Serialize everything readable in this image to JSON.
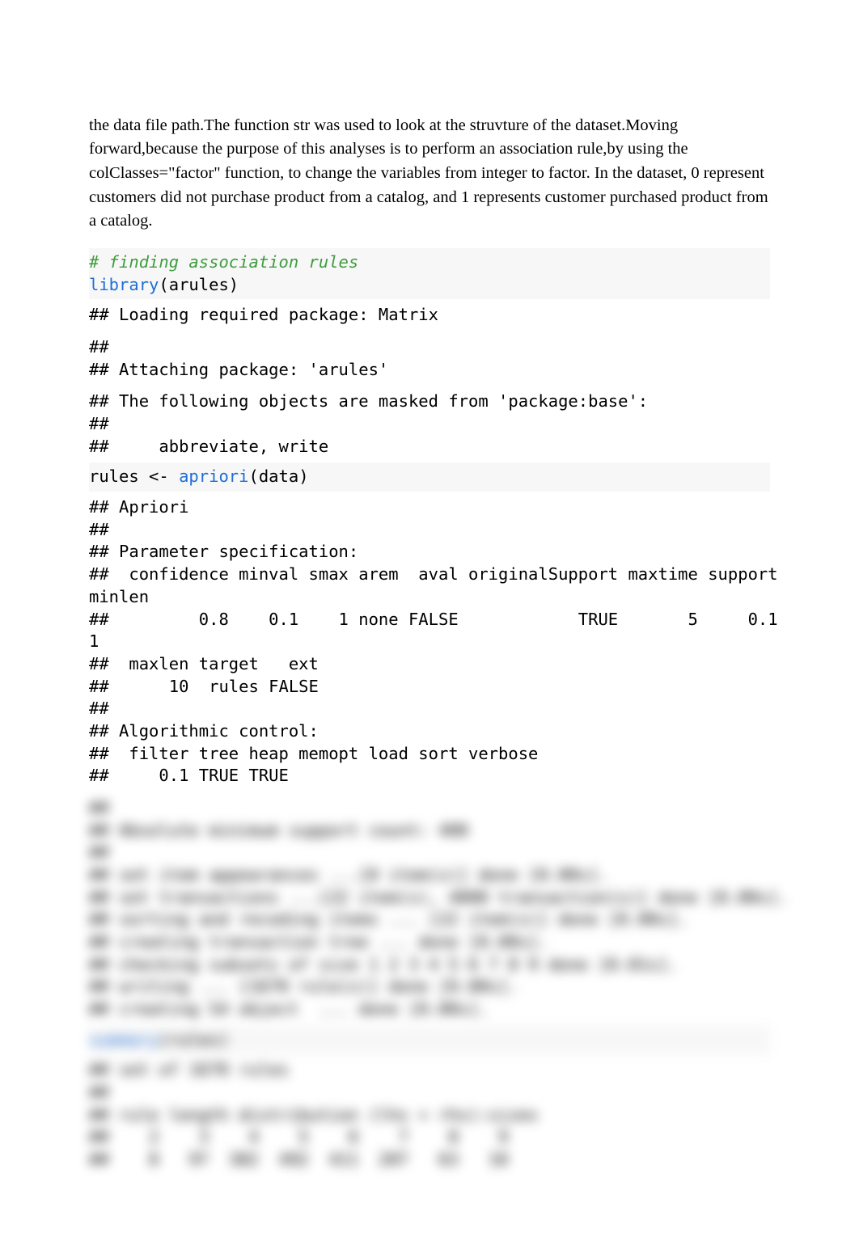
{
  "prose": {
    "p1": "the data file path.The function str was used to look at the struvture of the dataset.Moving forward,because the purpose of this analyses is to perform an association rule,by using the colClasses=\"factor\" function, to change the variables from integer to factor. In the dataset, 0 represent customers did not purchase product from a catalog, and 1 represents customer purchased product from a catalog."
  },
  "code1": {
    "comment": "# finding association rules",
    "fn_library": "library",
    "lib_arg": "(arules)"
  },
  "out1": {
    "line1": "## Loading required package: Matrix"
  },
  "out2": {
    "l1": "## ",
    "l2": "## Attaching package: 'arules'"
  },
  "out3": {
    "l1": "## The following objects are masked from 'package:base':",
    "l2": "## ",
    "l3": "##     abbreviate, write"
  },
  "code2": {
    "prefix": "rules <- ",
    "fn_apriori": "apriori",
    "arg": "(data)"
  },
  "out4": {
    "l1": "## Apriori",
    "l2": "## ",
    "l3": "## Parameter specification:",
    "l4": "##  confidence minval smax arem  aval originalSupport maxtime support",
    "l5": "minlen",
    "l6": "##         0.8    0.1    1 none FALSE            TRUE       5     0.1",
    "l7": "1",
    "l8": "##  maxlen target   ext",
    "l9": "##      10  rules FALSE",
    "l10": "## ",
    "l11": "## Algorithmic control:",
    "l12": "##  filter tree heap memopt load sort verbose",
    "l13": "##     0.1 TRUE TRUE  "
  },
  "blurred": {
    "l1": "##",
    "l2": "## Absolute minimum support count: 400",
    "l3": "##",
    "l4": "## set item appearances ...[0 item(s)] done [0.00s].",
    "l5": "## set transactions ...[22 item(s), 4000 transaction(s)] done [0.00s].",
    "l6": "## sorting and recoding items ... [22 item(s)] done [0.00s].",
    "l7": "## creating transaction tree ... done [0.00s].",
    "l8": "## checking subsets of size 1 2 3 4 5 6 7 8 9 done [0.01s].",
    "l9": "## writing ... [1670 rule(s)] done [0.00s].",
    "l10": "## creating S4 object  ... done [0.00s].",
    "code_fn": "summary",
    "code_arg": "(rules)",
    "s1": "## set of 1670 rules",
    "s2": "##",
    "s3": "## rule length distribution (lhs + rhs):sizes",
    "s4": "##    2    3    4    5    6    7    8    9 ",
    "s5": "##    8   97  382  492  411  207   63   10 "
  }
}
